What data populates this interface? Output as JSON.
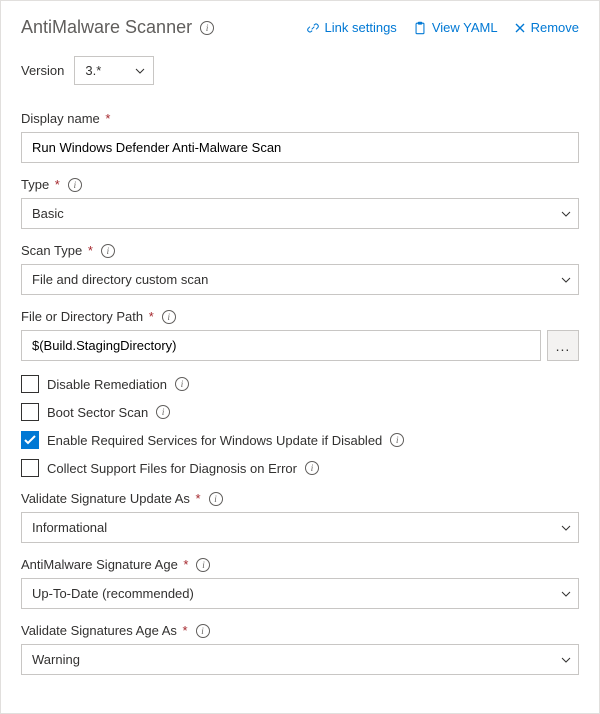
{
  "header": {
    "title": "AntiMalware Scanner",
    "actions": {
      "link_settings": "Link settings",
      "view_yaml": "View YAML",
      "remove": "Remove"
    }
  },
  "version": {
    "label": "Version",
    "value": "3.*"
  },
  "fields": {
    "display_name": {
      "label": "Display name",
      "value": "Run Windows Defender Anti-Malware Scan"
    },
    "type": {
      "label": "Type",
      "value": "Basic"
    },
    "scan_type": {
      "label": "Scan Type",
      "value": "File and directory custom scan"
    },
    "file_path": {
      "label": "File or Directory Path",
      "value": "$(Build.StagingDirectory)"
    },
    "checkboxes": {
      "disable_remediation": {
        "label": "Disable Remediation",
        "checked": false
      },
      "boot_sector": {
        "label": "Boot Sector Scan",
        "checked": false
      },
      "enable_services": {
        "label": "Enable Required Services for Windows Update if Disabled",
        "checked": true
      },
      "collect_support": {
        "label": "Collect Support Files for Diagnosis on Error",
        "checked": false
      }
    },
    "validate_update": {
      "label": "Validate Signature Update As",
      "value": "Informational"
    },
    "signature_age": {
      "label": "AntiMalware Signature Age",
      "value": "Up-To-Date (recommended)"
    },
    "validate_age": {
      "label": "Validate Signatures Age As",
      "value": "Warning"
    }
  },
  "more_btn": "..."
}
